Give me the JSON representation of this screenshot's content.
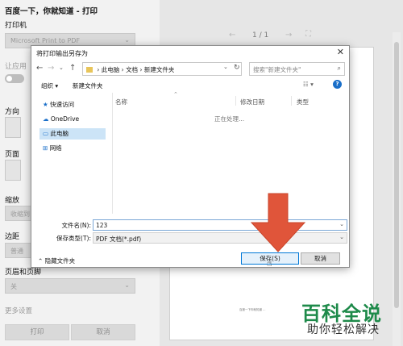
{
  "print_panel": {
    "title": "百度一下，你就知道 - 打印",
    "printer_label": "打印机",
    "printer_value": "Microsoft Print to PDF",
    "allow_label": "让应用",
    "orientation_label": "方向",
    "pages_label": "页面",
    "scale_label": "缩放",
    "scale_value": "收缩到",
    "margins_label": "边距",
    "margins_value": "普通",
    "header_footer_label": "页眉和页脚",
    "header_footer_value": "关",
    "more_settings": "更多设置",
    "print_button": "打印",
    "cancel_button": "取消",
    "chevron_icon": "chevron-down-icon"
  },
  "preview": {
    "page_indicator": "1 / 1",
    "prev_icon": "←",
    "next_icon": "→",
    "fit_icon": "⛶",
    "tiny_text": "百度一下你就知道 ..."
  },
  "dialog": {
    "title": "将打印输出另存为",
    "close_icon": "✕",
    "breadcrumb": [
      "此电脑",
      "文档",
      "新建文件夹"
    ],
    "search_placeholder": "搜索\"新建文件夹\"",
    "organize": "组织 ▾",
    "new_folder": "新建文件夹",
    "nav_items": [
      {
        "label": "快速访问",
        "icon": "pin-icon"
      },
      {
        "label": "OneDrive",
        "icon": "cloud-icon"
      },
      {
        "label": "此电脑",
        "icon": "computer-icon"
      },
      {
        "label": "网络",
        "icon": "network-icon"
      }
    ],
    "columns": [
      "名称",
      "修改日期",
      "类型"
    ],
    "processing_text": "正在处理...",
    "filename_label": "文件名(N):",
    "filename_value": "123",
    "filetype_label": "保存类型(T):",
    "filetype_value": "PDF 文档(*.pdf)",
    "hide_folders": "隐藏文件夹",
    "save_button": "保存(S)",
    "cancel_button": "取消"
  },
  "watermark": {
    "main": "百科全说",
    "sub": "助你轻松解决"
  },
  "colors": {
    "arrow": "#e0553a",
    "watermark_green": "#1e8a4a",
    "selected_nav": "#cce4f7",
    "save_border": "#0078d7"
  }
}
